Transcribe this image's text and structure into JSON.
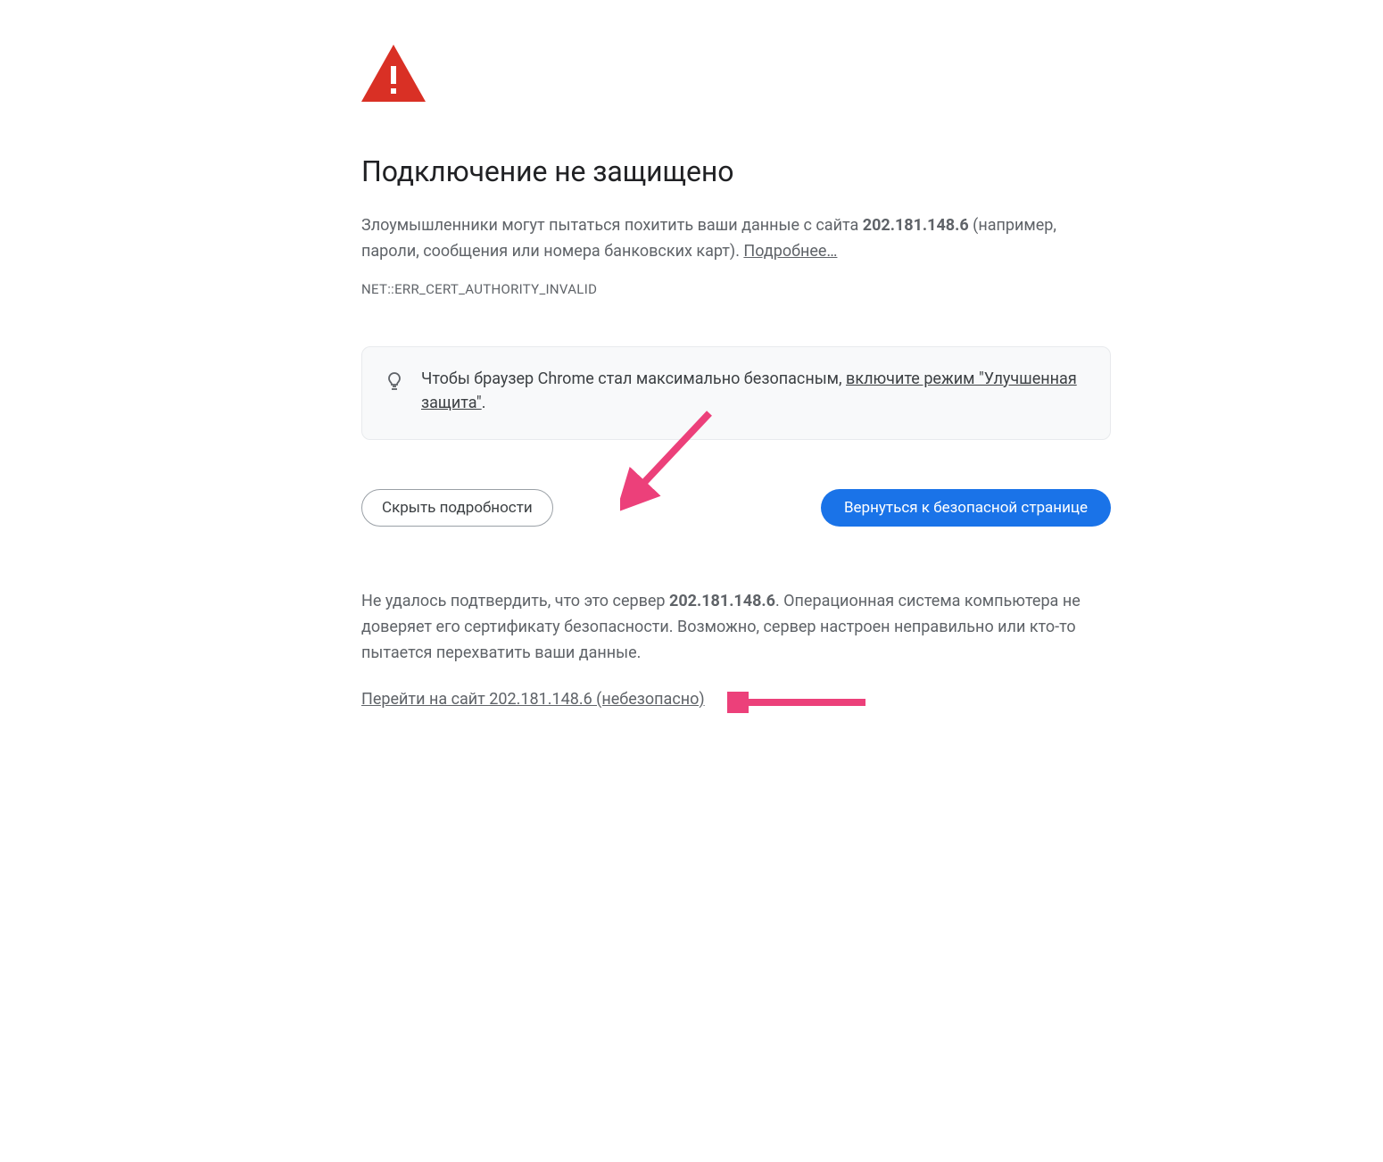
{
  "title": "Подключение не защищено",
  "description": {
    "prefix": "Злоумышленники могут пытаться похитить ваши данные с сайта ",
    "host": "202.181.148.6",
    "suffix": " (например, пароли, сообщения или номера банковских карт). "
  },
  "learn_more": "Подробнее…",
  "error_code": "NET::ERR_CERT_AUTHORITY_INVALID",
  "tip": {
    "prefix": "Чтобы браузер Chrome стал максимально безопасным, ",
    "link": "включите режим \"Улучшенная защита\"",
    "suffix": "."
  },
  "buttons": {
    "hide_details": "Скрыть подробности",
    "back_to_safety": "Вернуться к безопасной странице"
  },
  "details": {
    "prefix": "Не удалось подтвердить, что это сервер ",
    "host": "202.181.148.6",
    "suffix": ". Операционная система компьютера не доверяет его сертификату безопасности. Возможно, сервер настроен неправильно или кто-то пытается перехватить ваши данные."
  },
  "proceed_link": "Перейти на сайт 202.181.148.6 (небезопасно)",
  "colors": {
    "danger": "#d93025",
    "primary": "#1a73e8",
    "annotation": "#ec407a"
  }
}
